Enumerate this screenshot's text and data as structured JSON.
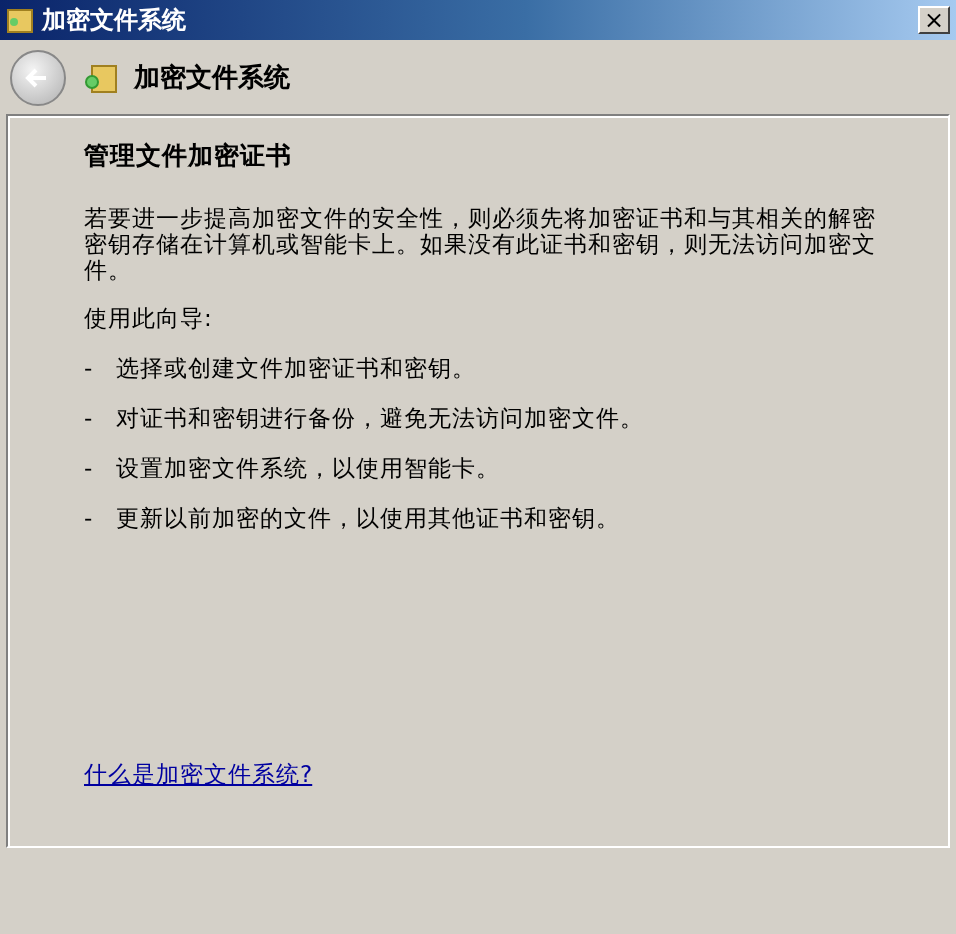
{
  "window": {
    "title": "加密文件系统",
    "close": "×"
  },
  "nav": {
    "title": "加密文件系统"
  },
  "content": {
    "heading": "管理文件加密证书",
    "intro": "若要进一步提高加密文件的安全性，则必须先将加密证书和与其相关的解密密钥存储在计算机或智能卡上。如果没有此证书和密钥，则无法访问加密文件。",
    "lead": "使用此向导:",
    "items": [
      {
        "bullet": "-",
        "text": "选择或创建文件加密证书和密钥。"
      },
      {
        "bullet": "-",
        "text": "对证书和密钥进行备份，避免无法访问加密文件。"
      },
      {
        "bullet": "-",
        "text": "设置加密文件系统，以使用智能卡。"
      },
      {
        "bullet": "-",
        "text": "更新以前加密的文件，以使用其他证书和密钥。"
      }
    ],
    "link": "什么是加密文件系统?"
  }
}
